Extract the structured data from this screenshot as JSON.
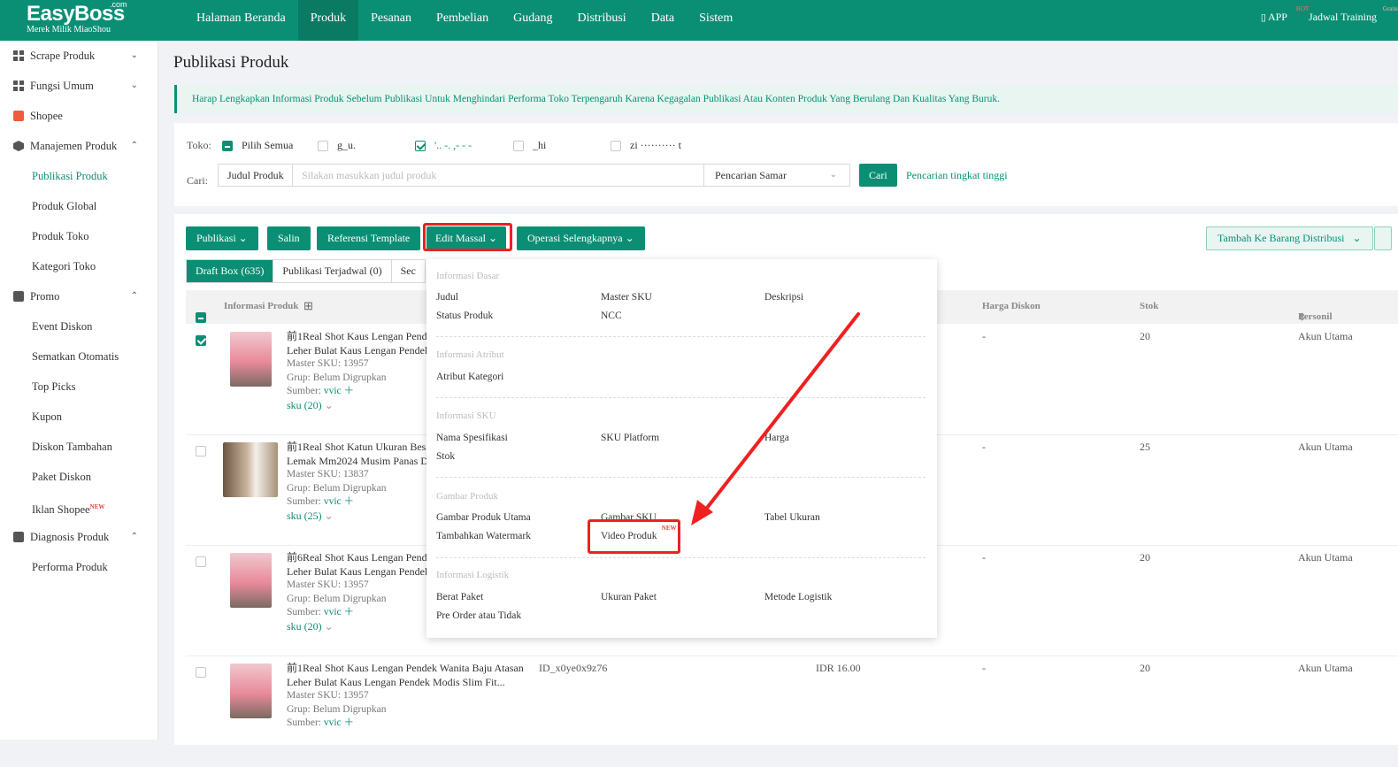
{
  "brand": {
    "name": "EasyBoss",
    "com": ".com",
    "subtitle": "Merek Milik MiaoShou"
  },
  "nav": [
    "Halaman Beranda",
    "Produk",
    "Pesanan",
    "Pembelian",
    "Gudang",
    "Distribusi",
    "Data",
    "Sistem"
  ],
  "nav_active": "Produk",
  "top_right": {
    "app": "APP",
    "app_badge": "HOT",
    "training": "Jadwal Training",
    "training_badge": "Gratis"
  },
  "sidebar": {
    "scrape": "Scrape Produk",
    "fungsi": "Fungsi Umum",
    "shopee": "Shopee",
    "manajemen": "Manajemen Produk",
    "publikasi": "Publikasi Produk",
    "global": "Produk Global",
    "toko": "Produk Toko",
    "kategori": "Kategori Toko",
    "promo": "Promo",
    "event": "Event Diskon",
    "sematkan": "Sematkan Otomatis",
    "top_picks": "Top Picks",
    "kupon": "Kupon",
    "diskon_tambahan": "Diskon Tambahan",
    "paket": "Paket Diskon",
    "iklan": "Iklan Shopee",
    "iklan_badge": "NEW",
    "diagnosis": "Diagnosis Produk",
    "performa": "Performa Produk"
  },
  "page_title": "Publikasi Produk",
  "notice": "Harap Lengkapkan Informasi Produk Sebelum Publikasi Untuk Menghindari Performa Toko Terpengaruh Karena Kegagalan Publikasi Atau Konten Produk Yang Berulang Dan Kualitas Yang Buruk.",
  "filter": {
    "toko_label": "Toko:",
    "pilih_semua": "Pilih Semua",
    "shops": [
      "g_u.",
      "'.. -. ,- - -",
      "_hi",
      "zi ·········· t"
    ],
    "cari_label": "Cari:",
    "search_type": "Judul Produk",
    "search_placeholder": "Silakan masukkan judul produk",
    "match": "Pencarian Samar",
    "cari_btn": "Cari",
    "advanced": "Pencarian tingkat tinggi"
  },
  "toolbar": {
    "publikasi": "Publikasi",
    "salin": "Salin",
    "referensi": "Referensi Template",
    "edit": "Edit Massal",
    "operasi": "Operasi Selengkapnya",
    "distribusi": "Tambah Ke Barang Distribusi"
  },
  "tabs": [
    "Draft Box (635)",
    "Publikasi Terjadwal (0)",
    "Sec"
  ],
  "table_head": {
    "info": "Informasi Produk",
    "harga_diskon": "Harga Diskon",
    "stok": "Stok",
    "personil": "Personil"
  },
  "rows": [
    {
      "title1": "前1Real Shot Kaus Lengan Pende",
      "title2": "Leher Bulat Kaus Lengan Pendek",
      "sku_label": "Master SKU:",
      "sku": "13957",
      "grup_label": "Grup:",
      "grup": "Belum Digrupkan",
      "sumber_label": "Sumber:",
      "sumber": "vvic",
      "skus": "sku (20)",
      "id": "",
      "harga": "",
      "diskon": "-",
      "stok": "20",
      "personil": "Akun Utama"
    },
    {
      "title1": "前1Real Shot Katun Ukuran Besa",
      "title2": "Lemak Mm2024 Musim Panas De",
      "sku_label": "Master SKU:",
      "sku": "13837",
      "grup_label": "Grup:",
      "grup": "Belum Digrupkan",
      "sumber_label": "Sumber:",
      "sumber": "vvic",
      "skus": "sku (25)",
      "id": "",
      "harga": "",
      "diskon": "-",
      "stok": "25",
      "personil": "Akun Utama"
    },
    {
      "title1": "前6Real Shot Kaus Lengan Pende",
      "title2": "Leher Bulat Kaus Lengan Pendek",
      "sku_label": "Master SKU:",
      "sku": "13957",
      "grup_label": "Grup:",
      "grup": "Belum Digrupkan",
      "sumber_label": "Sumber:",
      "sumber": "vvic",
      "skus": "sku (20)",
      "id": "",
      "harga": "",
      "diskon": "-",
      "stok": "20",
      "personil": "Akun Utama"
    },
    {
      "title1": "前1Real Shot Kaus Lengan Pendek Wanita Baju Atasan",
      "title2": "Leher Bulat Kaus Lengan Pendek Modis Slim Fit...",
      "sku_label": "Master SKU:",
      "sku": "13957",
      "grup_label": "Grup:",
      "grup": "Belum Digrupkan",
      "sumber_label": "Sumber:",
      "sumber": "vvic",
      "skus": "",
      "id": "ID_x0ye0x9z76",
      "harga": "IDR 16.00",
      "diskon": "-",
      "stok": "20",
      "personil": "Akun Utama"
    }
  ],
  "dropdown": {
    "dasar": "Informasi Dasar",
    "judul": "Judul",
    "master_sku": "Master SKU",
    "deskripsi": "Deskripsi",
    "status": "Status Produk",
    "ncc": "NCC",
    "atribut": "Informasi Atribut",
    "atribut_kategori": "Atribut Kategori",
    "sku_sec": "Informasi SKU",
    "nama_spes": "Nama Spesifikasi",
    "sku_platform": "SKU Platform",
    "harga": "Harga",
    "stok": "Stok",
    "gambar": "Gambar Produk",
    "gambar_utama": "Gambar Produk Utama",
    "gambar_sku": "Gambar SKU",
    "tabel": "Tabel Ukuran",
    "watermark": "Tambahkan Watermark",
    "video": "Video Produk",
    "video_badge": "NEW",
    "logistik": "Informasi Logistik",
    "berat": "Berat Paket",
    "ukuran": "Ukuran Paket",
    "metode": "Metode Logistik",
    "preorder": "Pre Order atau Tidak"
  }
}
